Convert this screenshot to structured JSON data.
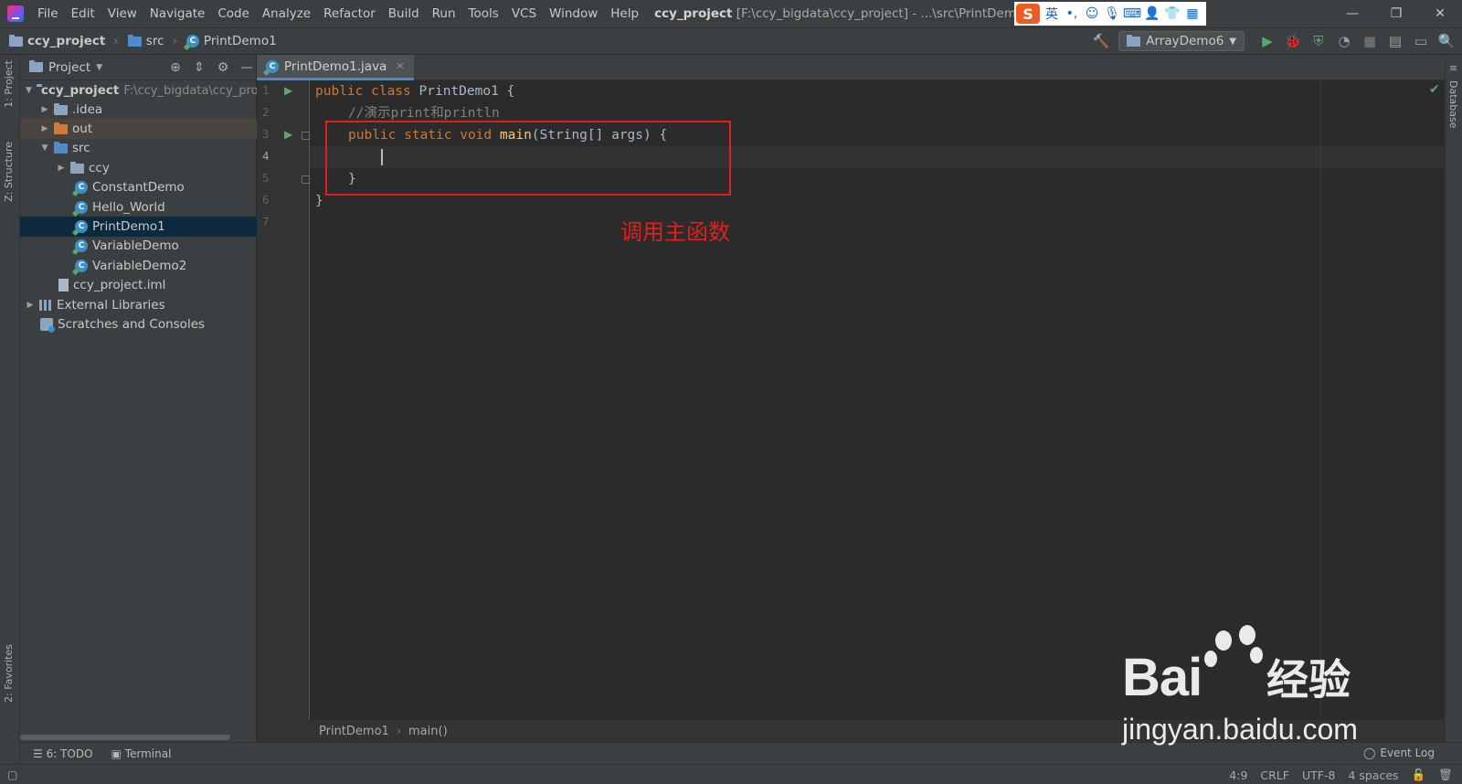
{
  "titlebar": {
    "menu": [
      "File",
      "Edit",
      "View",
      "Navigate",
      "Code",
      "Analyze",
      "Refactor",
      "Build",
      "Run",
      "Tools",
      "VCS",
      "Window",
      "Help"
    ],
    "project_name": "ccy_project",
    "title_rest": "[F:\\ccy_bigdata\\ccy_project] - ...\\src\\PrintDemo1.java - IntelliJ",
    "ime_lang": "英",
    "ime_logo": "S"
  },
  "navbar": {
    "crumbs": [
      "ccy_project",
      "src",
      "PrintDemo1"
    ],
    "run_config": "ArrayDemo6"
  },
  "left_strip": {
    "project_tab": "1: Project",
    "structure_tab": "Z: Structure",
    "favorites_tab": "2: Favorites"
  },
  "project_panel": {
    "title": "Project",
    "tree": [
      {
        "label": "ccy_project",
        "extra": "F:\\ccy_bigdata\\ccy_pro"
      },
      {
        "label": ".idea"
      },
      {
        "label": "out"
      },
      {
        "label": "src"
      },
      {
        "label": "ccy"
      },
      {
        "label": "ConstantDemo"
      },
      {
        "label": "Hello_World"
      },
      {
        "label": "PrintDemo1"
      },
      {
        "label": "VariableDemo"
      },
      {
        "label": "VariableDemo2"
      },
      {
        "label": "ccy_project.iml"
      },
      {
        "label": "External Libraries"
      },
      {
        "label": "Scratches and Consoles"
      }
    ]
  },
  "editor": {
    "tab_label": "PrintDemo1.java",
    "line_numbers": [
      "1",
      "2",
      "3",
      "4",
      "5",
      "6",
      "7"
    ],
    "lines": {
      "l1_kw": "public class ",
      "l1_rest": "PrintDemo1 {",
      "l2_comment": "//演示print和println",
      "l3_kw": "public static void ",
      "l3_fn": "main",
      "l3_rest": "(String[] args) {",
      "l5": "}",
      "l6": "}"
    },
    "annotation": "调用主函数",
    "breadcrumb": [
      "PrintDemo1",
      "main()"
    ]
  },
  "right_strip": {
    "database_tab": "Database"
  },
  "bottom_tools": {
    "todo": "6: TODO",
    "terminal": "Terminal",
    "event_log": "Event Log"
  },
  "statusbar": {
    "position": "4:9",
    "line_sep": "CRLF",
    "encoding": "UTF-8",
    "indent": "4 spaces"
  },
  "watermark": {
    "brand": "Bai",
    "brand_suffix": "经验",
    "url": "jingyan.baidu.com"
  }
}
